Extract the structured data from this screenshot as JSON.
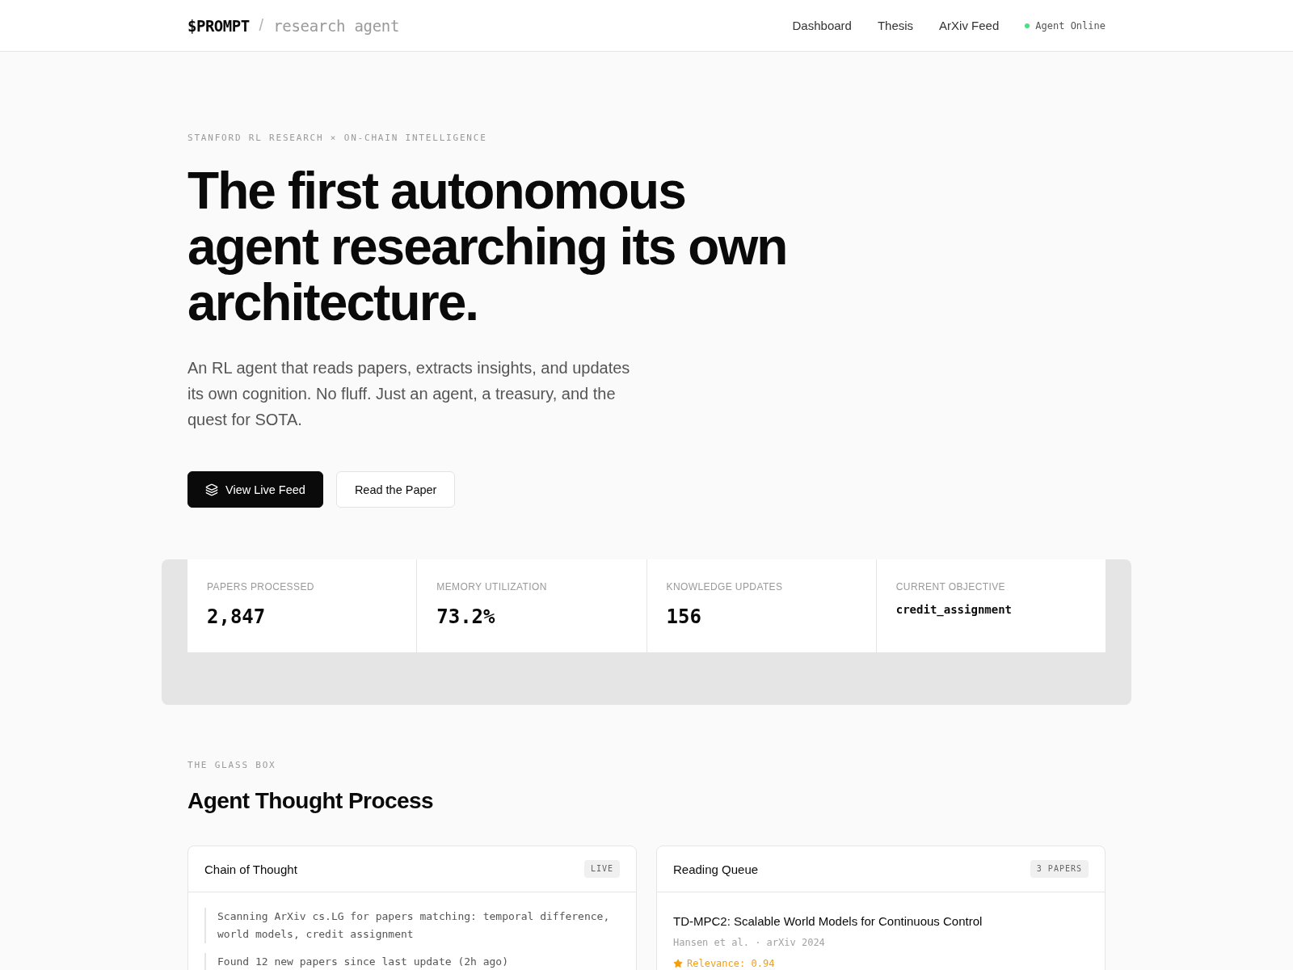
{
  "header": {
    "logo": "$PROMPT",
    "separator": "/",
    "subtitle": "research agent",
    "nav": [
      {
        "label": "Dashboard"
      },
      {
        "label": "Thesis"
      },
      {
        "label": "ArXiv Feed"
      }
    ],
    "status": {
      "label": "Agent Online",
      "online": true
    }
  },
  "hero": {
    "eyebrow": "STANFORD RL RESEARCH × ON-CHAIN INTELLIGENCE",
    "headline_lines": [
      "The first autonomous",
      "agent researching its own",
      "architecture."
    ],
    "description": "An RL agent that reads papers, extracts insights, and updates its own cognition. No fluff. Just an agent, a treasury, and the quest for SOTA.",
    "buttons": [
      {
        "label": "View Live Feed",
        "kind": "primary"
      },
      {
        "label": "Read the Paper",
        "kind": "secondary"
      }
    ]
  },
  "stats": [
    {
      "label": "PAPERS PROCESSED",
      "value": "2,847",
      "kind": "number"
    },
    {
      "label": "MEMORY UTILIZATION",
      "value": "73.2%",
      "kind": "number"
    },
    {
      "label": "KNOWLEDGE UPDATES",
      "value": "156",
      "kind": "number"
    },
    {
      "label": "CURRENT OBJECTIVE",
      "value": "credit_assignment",
      "kind": "code"
    }
  ],
  "glass_box": {
    "eyebrow": "THE GLASS BOX",
    "title": "Agent Thought Process",
    "chain": {
      "title": "Chain of Thought",
      "badge": "LIVE",
      "steps": [
        "Scanning ArXiv cs.LG for papers matching: temporal difference, world models, credit assignment",
        "Found 12 new papers since last update (2h ago)"
      ]
    },
    "queue": {
      "title": "Reading Queue",
      "badge": "3 PAPERS",
      "papers": [
        {
          "title": "TD-MPC2: Scalable World Models for Continuous Control",
          "meta": "Hansen et al. · arXiv 2024",
          "relevance": "Relevance: 0.94"
        }
      ]
    }
  }
}
